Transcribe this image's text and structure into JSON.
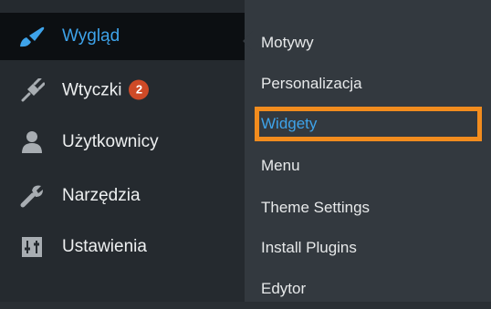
{
  "sidebar": {
    "items": [
      {
        "label": "Wygląd",
        "icon": "paintbrush-icon",
        "current": true
      },
      {
        "label": "Wtyczki",
        "icon": "plugin-icon",
        "badge": "2"
      },
      {
        "label": "Użytkownicy",
        "icon": "users-icon"
      },
      {
        "label": "Narzędzia",
        "icon": "wrench-icon"
      },
      {
        "label": "Ustawienia",
        "icon": "settings-icon"
      }
    ]
  },
  "submenu": {
    "items": [
      {
        "label": "Motywy"
      },
      {
        "label": "Personalizacja"
      },
      {
        "label": "Widgety",
        "highlighted": true
      },
      {
        "label": "Menu"
      },
      {
        "label": "Theme Settings"
      },
      {
        "label": "Install Plugins"
      },
      {
        "label": "Edytor"
      }
    ]
  },
  "colors": {
    "accent": "#3ea3ea",
    "highlight_frame": "#f28c1e",
    "badge": "#ce4a27"
  }
}
